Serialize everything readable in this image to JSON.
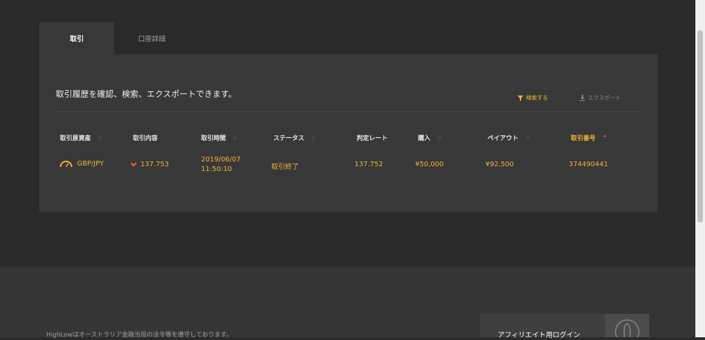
{
  "tabs": [
    {
      "label": "取引",
      "active": true
    },
    {
      "label": "口座詳細",
      "active": false
    }
  ],
  "panel": {
    "description": "取引履歴を確認、検索、エクスポートできます。",
    "search_label": "検索する",
    "export_label": "エクスポート"
  },
  "table": {
    "headers": [
      "取引原資産",
      "取引内容",
      "取引時間",
      "ステータス",
      "判定レート",
      "購入",
      "ペイアウト",
      "取引番号"
    ],
    "sorted_column": "取引番号",
    "rows": [
      {
        "asset": "GBP/JPY",
        "content_direction": "down",
        "content_rate": "137.753",
        "time_date": "2019/06/07",
        "time_clock": "11:50:10",
        "status": "取引終了",
        "judgement_rate": "137.752",
        "purchase": "¥50,000",
        "payout": "¥92,500",
        "trade_number": "374490441"
      }
    ]
  },
  "footer": {
    "legal_text": "HighLowはオーストラリア金融当局の法令等を遵守しております。",
    "affiliate_login": "アフィリエイト用ログイン"
  },
  "colors": {
    "accent": "#f2b632",
    "down": "#e8553a",
    "background": "#2a2a2a",
    "panel": "#383838"
  }
}
